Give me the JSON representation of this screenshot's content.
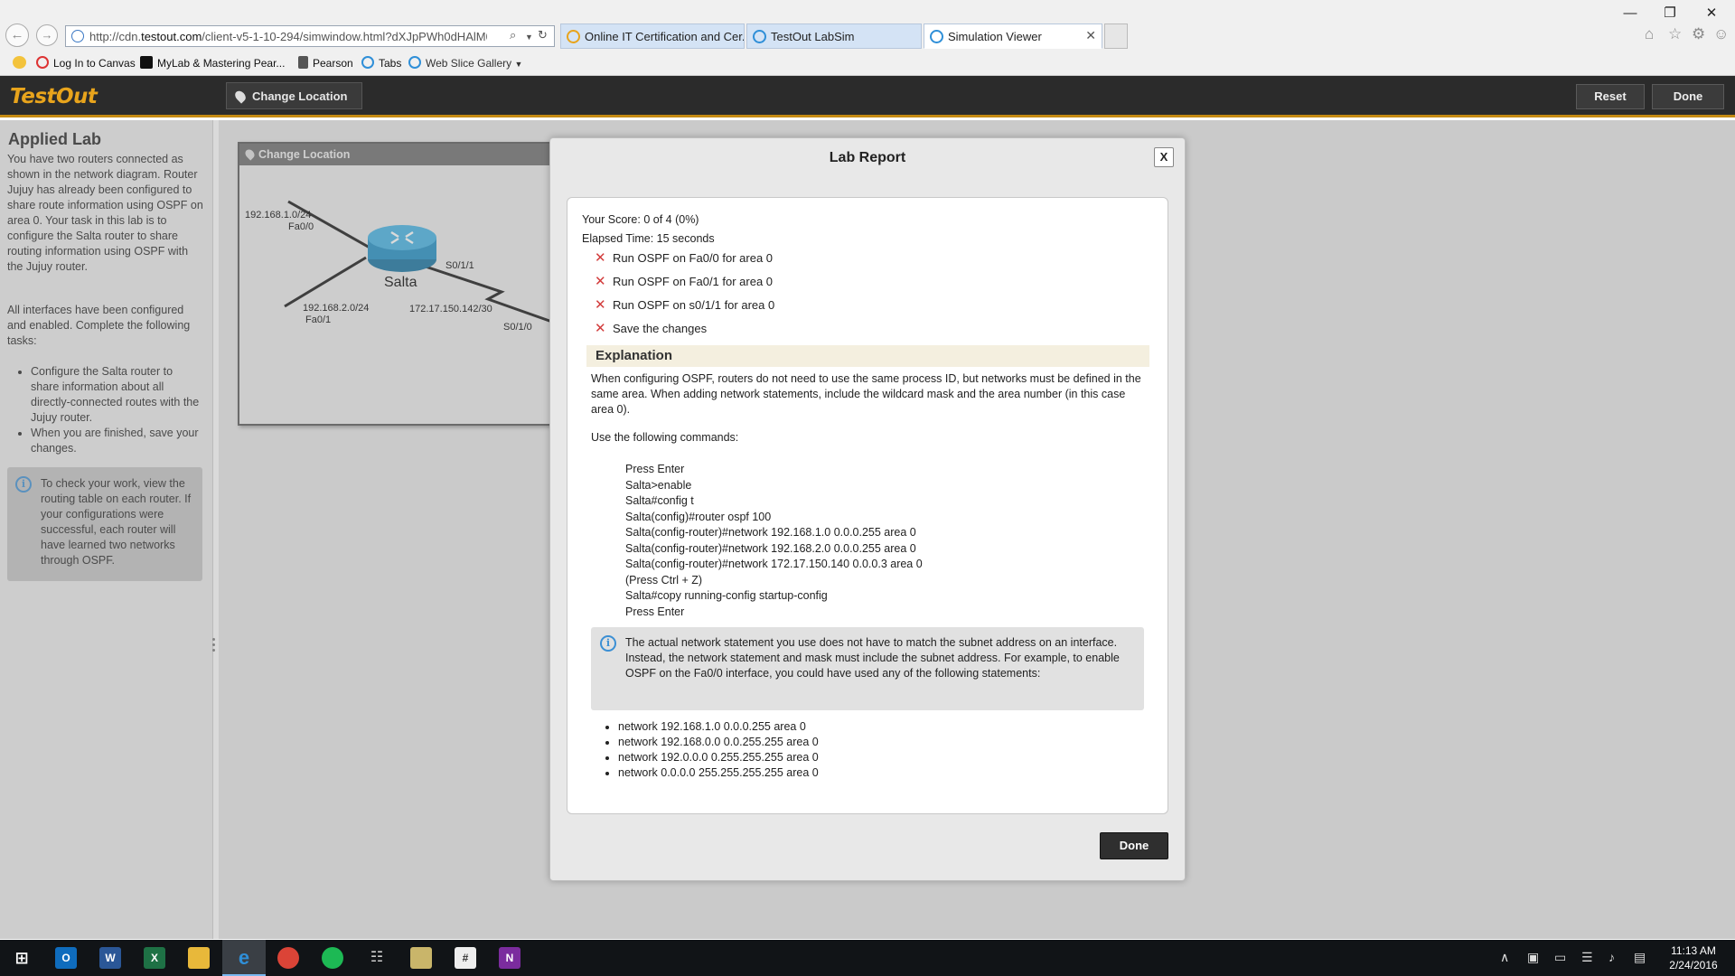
{
  "browser": {
    "url_prefix": "http://cdn.",
    "url_domain": "testout.com",
    "url_rest": "/client-v5-1-10-294/simwindow.html?dXJpPWh0dHAlM0ElMkYlM",
    "tabs": [
      {
        "label": "Online IT Certification and Cer..."
      },
      {
        "label": "TestOut LabSim"
      },
      {
        "label": "Simulation Viewer"
      }
    ],
    "favorites": [
      {
        "label": "Log In to Canvas"
      },
      {
        "label": "MyLab & Mastering  Pear..."
      },
      {
        "label": "Pearson"
      },
      {
        "label": "Tabs"
      },
      {
        "label": "Web Slice Gallery"
      }
    ]
  },
  "app": {
    "logo": "TestOut",
    "change_location": "Change Location",
    "reset": "Reset",
    "done": "Done"
  },
  "left_panel": {
    "title": "Applied Lab",
    "intro": "You have two routers connected as shown in the network diagram. Router Jujuy has already been configured to share route information using OSPF on area 0. Your task in this lab is to configure the Salta router to share routing information using OSPF with the Jujuy router.",
    "para2": "All interfaces have been configured and enabled. Complete the following tasks:",
    "tasks": [
      "Configure the Salta router to share information about all directly-connected routes with the Jujuy router.",
      "When you are finished, save your changes."
    ],
    "tip": "To check your work, view the routing table on each router. If your configurations were successful, each router will have learned two networks through OSPF."
  },
  "network_window": {
    "title": "Change Location",
    "labels": {
      "net1": "192.168.1.0/24",
      "if1": "Fa0/0",
      "net2": "192.168.2.0/24",
      "if2": "Fa0/1",
      "serial1": "S0/1/1",
      "serial_net": "172.17.150.142/30",
      "serial2": "S0/1/0",
      "router": "Salta"
    }
  },
  "lab_report": {
    "title": "Lab Report",
    "close": "X",
    "score": "Your Score: 0 of 4 (0%)",
    "elapsed": "Elapsed Time: 15 seconds",
    "results": [
      {
        "label": "Run OSPF on Fa0/0 for area 0",
        "passed": false
      },
      {
        "label": "Run OSPF on Fa0/1 for area 0",
        "passed": false
      },
      {
        "label": "Run OSPF on s0/1/1 for area 0",
        "passed": false
      },
      {
        "label": "Save the changes",
        "passed": false
      }
    ],
    "explanation_heading": "Explanation",
    "explanation": "When configuring OSPF, routers do not need to use the same process ID, but networks must be defined in the same area. When adding network statements, include the wildcard mask and the area number (in this case area 0).",
    "use_commands": "Use the following commands:",
    "commands": [
      "Press Enter",
      "Salta>enable",
      "Salta#config t",
      "Salta(config)#router ospf 100",
      "Salta(config-router)#network 192.168.1.0 0.0.0.255 area 0",
      "Salta(config-router)#network 192.168.2.0 0.0.0.255 area 0",
      "Salta(config-router)#network 172.17.150.140 0.0.0.3 area 0",
      "(Press Ctrl + Z)",
      "Salta#copy running-config startup-config",
      "Press Enter"
    ],
    "note": "The actual network statement you use does not have to match the subnet address on an interface. Instead, the network statement and mask must include the subnet address. For example, to enable OSPF on the Fa0/0 interface, you could have used any of the following statements:",
    "network_examples": [
      "network 192.168.1.0 0.0.0.255 area 0",
      "network 192.168.0.0 0.0.255.255 area 0",
      "network 192.0.0.0 0.255.255.255 area 0",
      "network 0.0.0.0 255.255.255.255 area 0"
    ],
    "done": "Done"
  },
  "taskbar": {
    "time": "11:13 AM",
    "date": "2/24/2016"
  },
  "colors": {
    "accent": "#e8a41c",
    "header_bg": "#2b2b2b",
    "fail": "#d23b3b",
    "router": "#1d8fc7"
  }
}
